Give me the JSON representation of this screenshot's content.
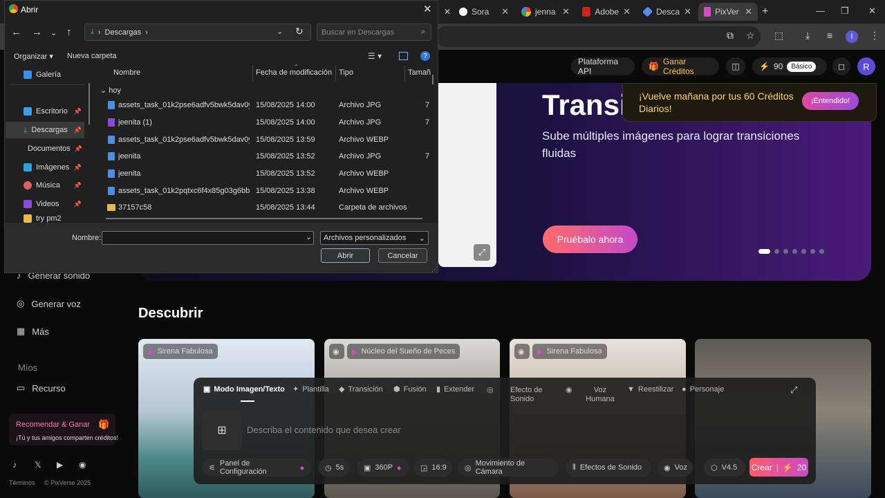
{
  "browser": {
    "tabs": [
      {
        "label": "",
        "icon": "x-icon"
      },
      {
        "label": "Sora",
        "icon": "sora-icon"
      },
      {
        "label": "jenna",
        "icon": "google-icon"
      },
      {
        "label": "Adobe",
        "icon": "adobe-icon"
      },
      {
        "label": "Desca",
        "icon": "gem-icon"
      },
      {
        "label": "PixVer",
        "icon": "pixverse-icon"
      }
    ],
    "new_tab": "+",
    "profile_initial": "I"
  },
  "site": {
    "header": {
      "api": "Plataforma API",
      "credits_link": "Ganar Créditos",
      "credits_count": "90",
      "plan": "Básico",
      "avatar": "R"
    },
    "hero": {
      "title": "Transic",
      "subtitle": "Sube múltiples imágenes para lograr transiciones fluidas",
      "cta": "Pruébalo ahora"
    },
    "notice": {
      "text": "¡Vuelve mañana por tus 60 Créditos Diarios!",
      "button": "¡Entendido!"
    },
    "sidebar": {
      "items": [
        "Generar sonido",
        "Generar voz",
        "Más"
      ],
      "section": "Míos",
      "recurso": "Recurso",
      "recommend_title": "Recomendar & Ganar",
      "recommend_sub": "¡Tú y tus amigos comparten créditos!",
      "footer_terms": "Términos",
      "footer_copy": "© PixVerse 2025"
    },
    "discover": {
      "title": "Descubrir",
      "cards": [
        {
          "label": "Sirena Fabulosa"
        },
        {
          "label": "Núcleo del Sueño de Peces"
        },
        {
          "label": "Sirena Fabulosa"
        },
        {
          "label": ""
        }
      ]
    },
    "composer": {
      "modes": [
        "Modo Imagen/Texto",
        "Plantilla",
        "Transición",
        "Fusión",
        "Extender",
        "Efecto de Sonido",
        "Voz Humana",
        "Reestilizar",
        "Personaje"
      ],
      "placeholder": "Describa el contenido que desea crear",
      "chips": [
        "Panel de Configuración",
        "5s",
        "360P",
        "16:9",
        "Movimiento de Cámara",
        "Efectos de Sonido",
        "Voz",
        "V4.5"
      ],
      "create": "Crear",
      "create_cost": "20"
    }
  },
  "dialog": {
    "title": "Abrir",
    "breadcrumb": "Descargas",
    "search_placeholder": "Buscar en Descargas",
    "organize": "Organizar",
    "new_folder": "Nueva carpeta",
    "nav_items": [
      {
        "label": "Galería",
        "pinned": false
      },
      {
        "label": "Escritorio",
        "pinned": true
      },
      {
        "label": "Descargas",
        "pinned": true
      },
      {
        "label": "Documentos",
        "pinned": true
      },
      {
        "label": "Imágenes",
        "pinned": true
      },
      {
        "label": "Música",
        "pinned": true
      },
      {
        "label": "Videos",
        "pinned": true
      },
      {
        "label": "try pm2",
        "pinned": false
      }
    ],
    "columns": [
      "Nombre",
      "Fecha de modificación",
      "Tipo",
      "Tamañ"
    ],
    "group": "hoy",
    "files": [
      {
        "name": "assets_task_01k2pse6adfv5bwk5dav0ygkr...",
        "date": "15/08/2025 14:00",
        "type": "Archivo JPG",
        "size": "7"
      },
      {
        "name": "jeenita (1)",
        "date": "15/08/2025 14:00",
        "type": "Archivo JPG",
        "size": "7"
      },
      {
        "name": "assets_task_01k2pse6adfv5bwk5dav0ygkr...",
        "date": "15/08/2025 13:59",
        "type": "Archivo WEBP",
        "size": ""
      },
      {
        "name": "jeenita",
        "date": "15/08/2025 13:52",
        "type": "Archivo JPG",
        "size": "7"
      },
      {
        "name": "jeenita",
        "date": "15/08/2025 13:52",
        "type": "Archivo WEBP",
        "size": ""
      },
      {
        "name": "assets_task_01k2pqtxc6f4x85g03g6bb407...",
        "date": "15/08/2025 13:38",
        "type": "Archivo WEBP",
        "size": ""
      },
      {
        "name": "37157c58",
        "date": "15/08/2025 13:44",
        "type": "Carpeta de archivos",
        "size": ""
      }
    ],
    "name_label": "Nombre:",
    "name_value": "",
    "filter": "Archivos personalizados",
    "open": "Abrir",
    "cancel": "Cancelar"
  }
}
